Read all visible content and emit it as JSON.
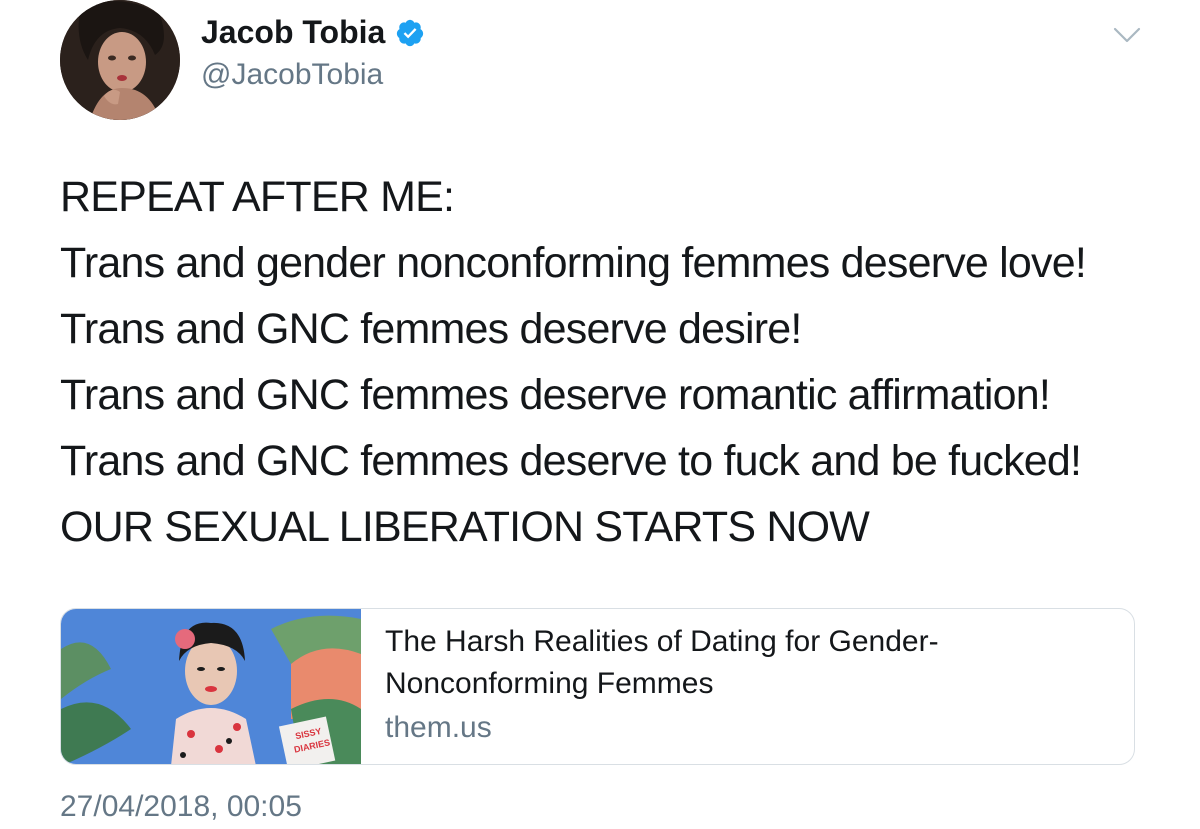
{
  "author": {
    "name": "Jacob Tobia",
    "handle": "@JacobTobia",
    "verified": true,
    "verified_color": "#1da1f2"
  },
  "tweet": {
    "lines": [
      "REPEAT AFTER ME:",
      "Trans and gender nonconforming femmes deserve love!",
      "Trans and GNC femmes deserve desire!",
      "Trans and GNC femmes deserve romantic affirmation!",
      "Trans and GNC femmes deserve to fuck and be fucked!",
      "OUR SEXUAL LIBERATION STARTS NOW"
    ]
  },
  "card": {
    "title": "The Harsh Realities of Dating for Gender-Nonconforming Femmes",
    "domain": "them.us",
    "thumbnail_text": [
      "SISSY",
      "DIARIES"
    ]
  },
  "timestamp": "27/04/2018, 00:05",
  "icons": {
    "verified": "verified-badge-icon",
    "more": "chevron-down-icon"
  }
}
